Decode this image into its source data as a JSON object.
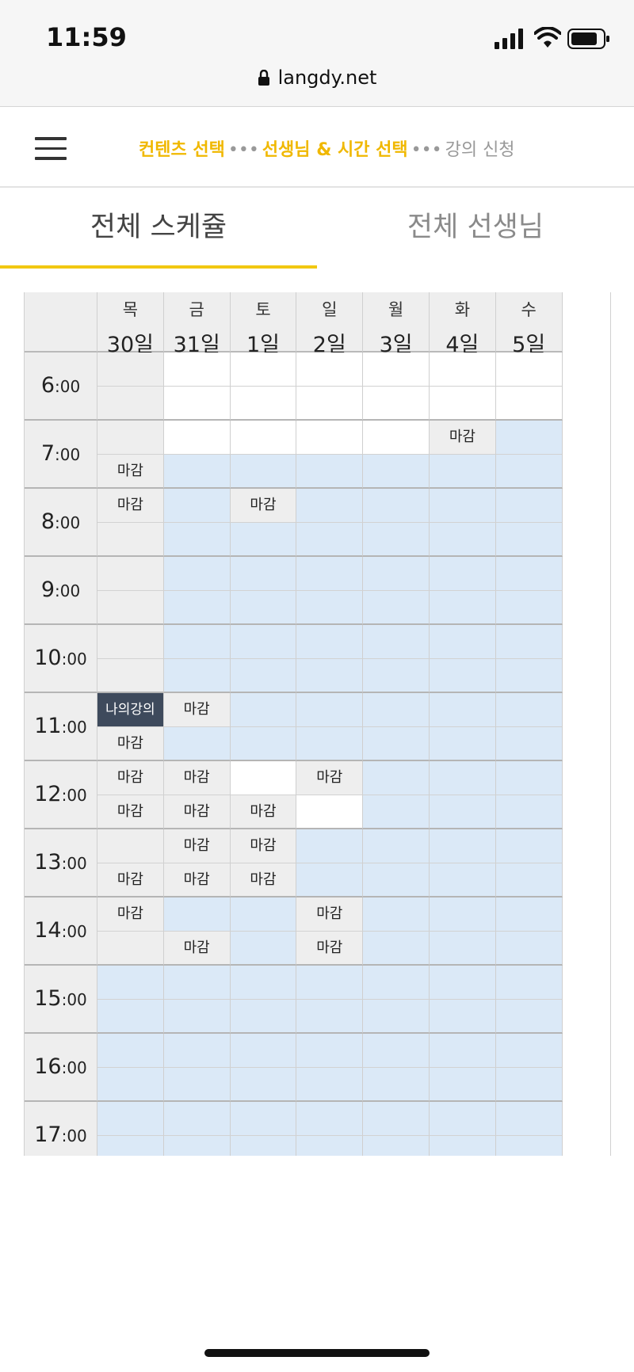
{
  "status_bar": {
    "time": "11:59"
  },
  "browser": {
    "url": "langdy.net"
  },
  "header": {
    "steps": [
      {
        "label": "컨텐츠 선택",
        "active": true
      },
      {
        "label": "선생님 & 시간 선택",
        "active": true
      },
      {
        "label": "강의 신청",
        "active": false
      }
    ],
    "step_separator": "•••",
    "accent_color": "#f2c811"
  },
  "tabs": [
    {
      "label": "전체 스케쥴",
      "selected": true
    },
    {
      "label": "전체 선생님",
      "selected": false
    }
  ],
  "schedule": {
    "days": [
      {
        "dow": "목",
        "date": "30일"
      },
      {
        "dow": "금",
        "date": "31일"
      },
      {
        "dow": "토",
        "date": "1일"
      },
      {
        "dow": "일",
        "date": "2일"
      },
      {
        "dow": "월",
        "date": "3일"
      },
      {
        "dow": "화",
        "date": "4일"
      },
      {
        "dow": "수",
        "date": "5일"
      }
    ],
    "hours": [
      {
        "hour": "6",
        "min": ":00"
      },
      {
        "hour": "7",
        "min": ":00"
      },
      {
        "hour": "8",
        "min": ":00"
      },
      {
        "hour": "9",
        "min": ":00"
      },
      {
        "hour": "10",
        "min": ":00"
      },
      {
        "hour": "11",
        "min": ":00"
      },
      {
        "hour": "12",
        "min": ":00"
      },
      {
        "hour": "13",
        "min": ":00"
      },
      {
        "hour": "14",
        "min": ":00"
      },
      {
        "hour": "15",
        "min": ":00"
      },
      {
        "hour": "16",
        "min": ":00"
      },
      {
        "hour": "17",
        "min": ":00"
      }
    ],
    "legend_colors": {
      "closed": "#eeeeee",
      "open": "#dbe9f7",
      "empty": "#ffffff",
      "mine": "#3e4a5c"
    },
    "rows": [
      [
        [
          "closed",
          ""
        ],
        [
          "empty",
          ""
        ],
        [
          "empty",
          ""
        ],
        [
          "empty",
          ""
        ],
        [
          "empty",
          ""
        ],
        [
          "empty",
          ""
        ],
        [
          "empty",
          ""
        ]
      ],
      [
        [
          "closed",
          ""
        ],
        [
          "empty",
          ""
        ],
        [
          "empty",
          ""
        ],
        [
          "empty",
          ""
        ],
        [
          "empty",
          ""
        ],
        [
          "empty",
          ""
        ],
        [
          "empty",
          ""
        ]
      ],
      [
        [
          "closed",
          ""
        ],
        [
          "empty",
          ""
        ],
        [
          "empty",
          ""
        ],
        [
          "empty",
          ""
        ],
        [
          "empty",
          ""
        ],
        [
          "closed",
          "마감"
        ],
        [
          "open",
          ""
        ]
      ],
      [
        [
          "closed",
          "마감"
        ],
        [
          "open",
          ""
        ],
        [
          "open",
          ""
        ],
        [
          "open",
          ""
        ],
        [
          "open",
          ""
        ],
        [
          "open",
          ""
        ],
        [
          "open",
          ""
        ]
      ],
      [
        [
          "closed",
          "마감"
        ],
        [
          "open",
          ""
        ],
        [
          "closed",
          "마감"
        ],
        [
          "open",
          ""
        ],
        [
          "open",
          ""
        ],
        [
          "open",
          ""
        ],
        [
          "open",
          ""
        ]
      ],
      [
        [
          "closed",
          ""
        ],
        [
          "open",
          ""
        ],
        [
          "open",
          ""
        ],
        [
          "open",
          ""
        ],
        [
          "open",
          ""
        ],
        [
          "open",
          ""
        ],
        [
          "open",
          ""
        ]
      ],
      [
        [
          "closed",
          ""
        ],
        [
          "open",
          ""
        ],
        [
          "open",
          ""
        ],
        [
          "open",
          ""
        ],
        [
          "open",
          ""
        ],
        [
          "open",
          ""
        ],
        [
          "open",
          ""
        ]
      ],
      [
        [
          "closed",
          ""
        ],
        [
          "open",
          ""
        ],
        [
          "open",
          ""
        ],
        [
          "open",
          ""
        ],
        [
          "open",
          ""
        ],
        [
          "open",
          ""
        ],
        [
          "open",
          ""
        ]
      ],
      [
        [
          "closed",
          ""
        ],
        [
          "open",
          ""
        ],
        [
          "open",
          ""
        ],
        [
          "open",
          ""
        ],
        [
          "open",
          ""
        ],
        [
          "open",
          ""
        ],
        [
          "open",
          ""
        ]
      ],
      [
        [
          "closed",
          ""
        ],
        [
          "open",
          ""
        ],
        [
          "open",
          ""
        ],
        [
          "open",
          ""
        ],
        [
          "open",
          ""
        ],
        [
          "open",
          ""
        ],
        [
          "open",
          ""
        ]
      ],
      [
        [
          "mine",
          "나의강의"
        ],
        [
          "closed",
          "마감"
        ],
        [
          "open",
          ""
        ],
        [
          "open",
          ""
        ],
        [
          "open",
          ""
        ],
        [
          "open",
          ""
        ],
        [
          "open",
          ""
        ]
      ],
      [
        [
          "closed",
          "마감"
        ],
        [
          "open",
          ""
        ],
        [
          "open",
          ""
        ],
        [
          "open",
          ""
        ],
        [
          "open",
          ""
        ],
        [
          "open",
          ""
        ],
        [
          "open",
          ""
        ]
      ],
      [
        [
          "closed",
          "마감"
        ],
        [
          "closed",
          "마감"
        ],
        [
          "empty",
          ""
        ],
        [
          "closed",
          "마감"
        ],
        [
          "open",
          ""
        ],
        [
          "open",
          ""
        ],
        [
          "open",
          ""
        ]
      ],
      [
        [
          "closed",
          "마감"
        ],
        [
          "closed",
          "마감"
        ],
        [
          "closed",
          "마감"
        ],
        [
          "empty",
          ""
        ],
        [
          "open",
          ""
        ],
        [
          "open",
          ""
        ],
        [
          "open",
          ""
        ]
      ],
      [
        [
          "closed",
          ""
        ],
        [
          "closed",
          "마감"
        ],
        [
          "closed",
          "마감"
        ],
        [
          "open",
          ""
        ],
        [
          "open",
          ""
        ],
        [
          "open",
          ""
        ],
        [
          "open",
          ""
        ]
      ],
      [
        [
          "closed",
          "마감"
        ],
        [
          "closed",
          "마감"
        ],
        [
          "closed",
          "마감"
        ],
        [
          "open",
          ""
        ],
        [
          "open",
          ""
        ],
        [
          "open",
          ""
        ],
        [
          "open",
          ""
        ]
      ],
      [
        [
          "closed",
          "마감"
        ],
        [
          "open",
          ""
        ],
        [
          "open",
          ""
        ],
        [
          "closed",
          "마감"
        ],
        [
          "open",
          ""
        ],
        [
          "open",
          ""
        ],
        [
          "open",
          ""
        ]
      ],
      [
        [
          "closed",
          ""
        ],
        [
          "closed",
          "마감"
        ],
        [
          "open",
          ""
        ],
        [
          "closed",
          "마감"
        ],
        [
          "open",
          ""
        ],
        [
          "open",
          ""
        ],
        [
          "open",
          ""
        ]
      ],
      [
        [
          "open",
          ""
        ],
        [
          "open",
          ""
        ],
        [
          "open",
          ""
        ],
        [
          "open",
          ""
        ],
        [
          "open",
          ""
        ],
        [
          "open",
          ""
        ],
        [
          "open",
          ""
        ]
      ],
      [
        [
          "open",
          ""
        ],
        [
          "open",
          ""
        ],
        [
          "open",
          ""
        ],
        [
          "open",
          ""
        ],
        [
          "open",
          ""
        ],
        [
          "open",
          ""
        ],
        [
          "open",
          ""
        ]
      ],
      [
        [
          "open",
          ""
        ],
        [
          "open",
          ""
        ],
        [
          "open",
          ""
        ],
        [
          "open",
          ""
        ],
        [
          "open",
          ""
        ],
        [
          "open",
          ""
        ],
        [
          "open",
          ""
        ]
      ],
      [
        [
          "open",
          ""
        ],
        [
          "open",
          ""
        ],
        [
          "open",
          ""
        ],
        [
          "open",
          ""
        ],
        [
          "open",
          ""
        ],
        [
          "open",
          ""
        ],
        [
          "open",
          ""
        ]
      ],
      [
        [
          "open",
          ""
        ],
        [
          "open",
          ""
        ],
        [
          "open",
          ""
        ],
        [
          "open",
          ""
        ],
        [
          "open",
          ""
        ],
        [
          "open",
          ""
        ],
        [
          "open",
          ""
        ]
      ],
      [
        [
          "open",
          ""
        ],
        [
          "open",
          ""
        ],
        [
          "open",
          ""
        ],
        [
          "open",
          ""
        ],
        [
          "open",
          ""
        ],
        [
          "open",
          ""
        ],
        [
          "open",
          ""
        ]
      ]
    ]
  }
}
